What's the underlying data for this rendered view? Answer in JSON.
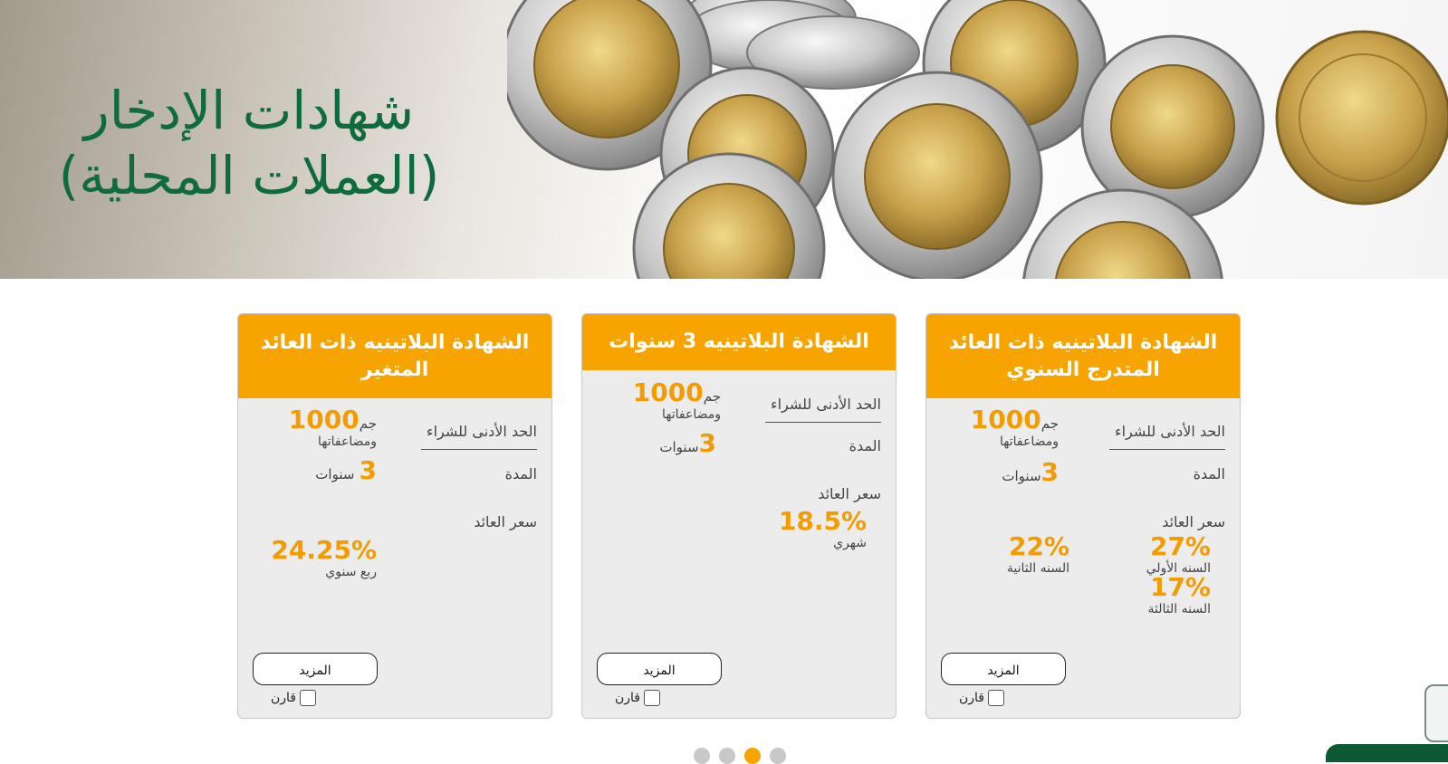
{
  "hero": {
    "title_line1": "شهادات الإدخار",
    "title_line2": "(العملات المحلية)"
  },
  "colors": {
    "accent": "#f7a400",
    "brand_green": "#0e6b3e",
    "card_bg": "#ececec"
  },
  "cards": [
    {
      "title": "الشهادة البلاتينيه ذات العائد المتدرج السنوي",
      "min_label": "الحد الأدنى للشراء",
      "min_amount": "1000",
      "currency": "جم",
      "multiples": "ومضاعفاتها",
      "duration_label": "المدة",
      "duration_value": "3",
      "duration_unit": "سنوات",
      "rate_label": "سعر العائد",
      "rates": [
        {
          "value": "27%",
          "note": "السنه الأولي"
        },
        {
          "value": "22%",
          "note": "السنه الثانية"
        },
        {
          "value": "17%",
          "note": "السنه الثالثة"
        }
      ],
      "more_label": "المزيد",
      "compare_label": "قارن"
    },
    {
      "title": "الشهادة البلاتينيه 3 سنوات",
      "min_label": "الحد الأدنى للشراء",
      "min_amount": "1000",
      "currency": "جم",
      "multiples": "ومضاعفاتها",
      "duration_label": "المدة",
      "duration_value": "3",
      "duration_unit": "سنوات",
      "rate_label": "سعر العائد",
      "rates": [
        {
          "value": "18.5%",
          "note": "شهري"
        }
      ],
      "more_label": "المزيد",
      "compare_label": "قارن"
    },
    {
      "title": "الشهادة البلاتينيه ذات العائد المتغير",
      "min_label": "الحد الأدنى للشراء",
      "min_amount": "1000",
      "currency": "جم",
      "multiples": "ومضاعفاتها",
      "duration_label": "المدة",
      "duration_value": "3",
      "duration_unit": "سنوات",
      "rate_label": "سعر العائد",
      "rates": [
        {
          "value": "24.25%",
          "note": "ربع سنوي"
        }
      ],
      "more_label": "المزيد",
      "compare_label": "قارن"
    }
  ],
  "carousel": {
    "total": 4,
    "active_index": 2
  }
}
